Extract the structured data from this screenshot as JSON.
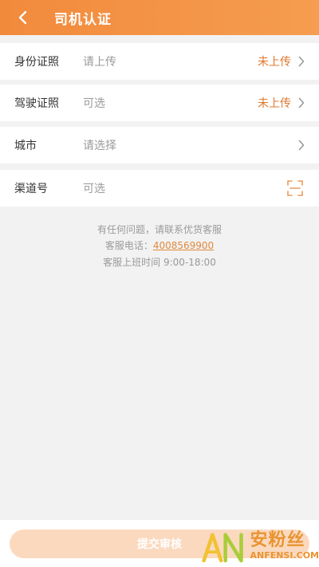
{
  "header": {
    "title": "司机认证",
    "back_icon": "chevron-left-icon"
  },
  "form": {
    "rows": [
      {
        "label": "身份证照",
        "value": "请上传",
        "status": "未上传",
        "trailing_icon": "chevron-right-icon"
      },
      {
        "label": "驾驶证照",
        "value": "可选",
        "status": "未上传",
        "trailing_icon": "chevron-right-icon"
      },
      {
        "label": "城市",
        "value": "请选择",
        "status": "",
        "trailing_icon": "chevron-right-icon"
      },
      {
        "label": "渠道号",
        "value": "可选",
        "status": "",
        "trailing_icon": "scan-icon"
      }
    ]
  },
  "help": {
    "line1": "有任何问题，请联系优货客服",
    "phone_label": "客服电话：",
    "phone": "4008569900",
    "hours": "客服上班时间 9:00-18:00"
  },
  "footer": {
    "submit_label": "提交审核"
  },
  "watermark": {
    "logo_text": "AN",
    "cn": "安粉丝",
    "en": "ANFENSI.COM"
  },
  "colors": {
    "header": "#f28a3c",
    "status": "#e0772d",
    "phone_link": "#e0893a",
    "submit_disabled": "#fbd9bf",
    "background": "#f2f2f2"
  }
}
